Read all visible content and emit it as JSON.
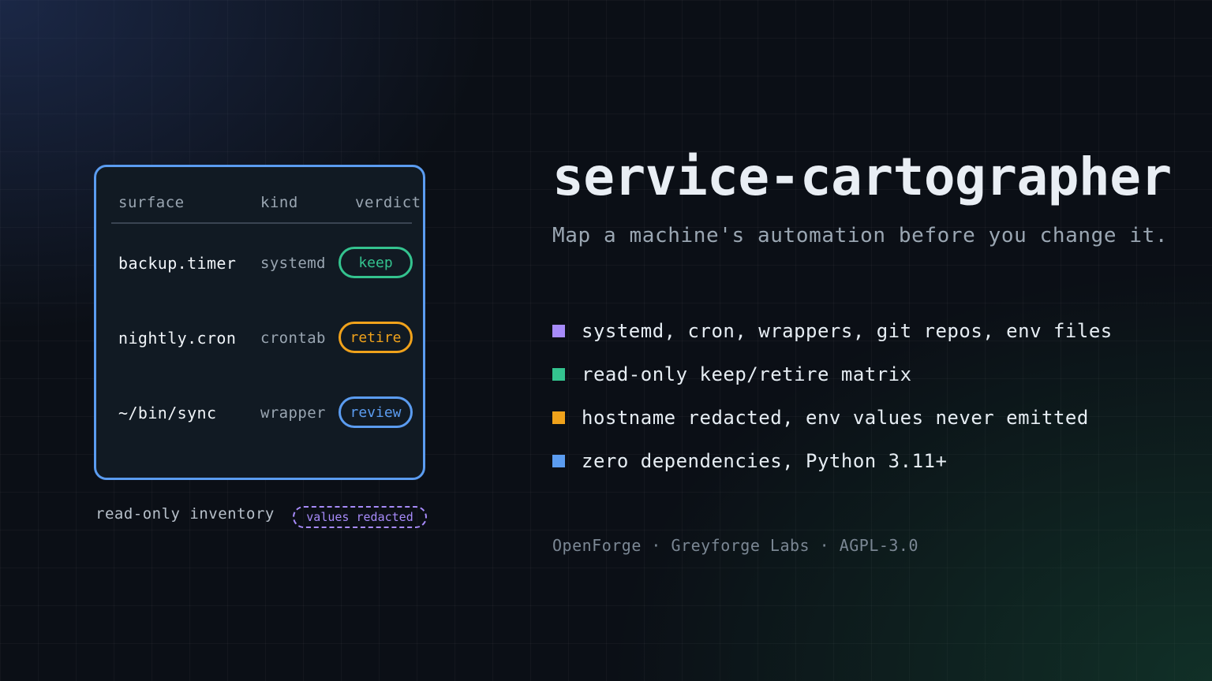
{
  "inventory": {
    "headers": {
      "surface": "surface",
      "kind": "kind",
      "verdict": "verdict"
    },
    "rows": [
      {
        "surface": "backup.timer",
        "kind": "systemd",
        "verdict": "keep"
      },
      {
        "surface": "nightly.cron",
        "kind": "crontab",
        "verdict": "retire"
      },
      {
        "surface": "~/bin/sync",
        "kind": "wrapper",
        "verdict": "review"
      }
    ],
    "caption": "read-only inventory",
    "badge": "values redacted"
  },
  "project": {
    "title": "service-cartographer",
    "tagline": "Map a machine's automation before you change it.",
    "features": [
      {
        "text": "systemd, cron, wrappers, git repos, env files",
        "color": "#a78bfa"
      },
      {
        "text": "read-only keep/retire matrix",
        "color": "#34c38f"
      },
      {
        "text": "hostname redacted, env values never emitted",
        "color": "#f0a21b"
      },
      {
        "text": "zero dependencies, Python 3.11+",
        "color": "#5b9cf0"
      }
    ],
    "footer": "OpenForge · Greyforge Labs · AGPL-3.0"
  },
  "colors": {
    "panel_border": "#5b9cf0",
    "keep": "#34c38f",
    "retire": "#f0a21b",
    "review": "#5b9cf0",
    "redacted": "#a78bfa"
  }
}
